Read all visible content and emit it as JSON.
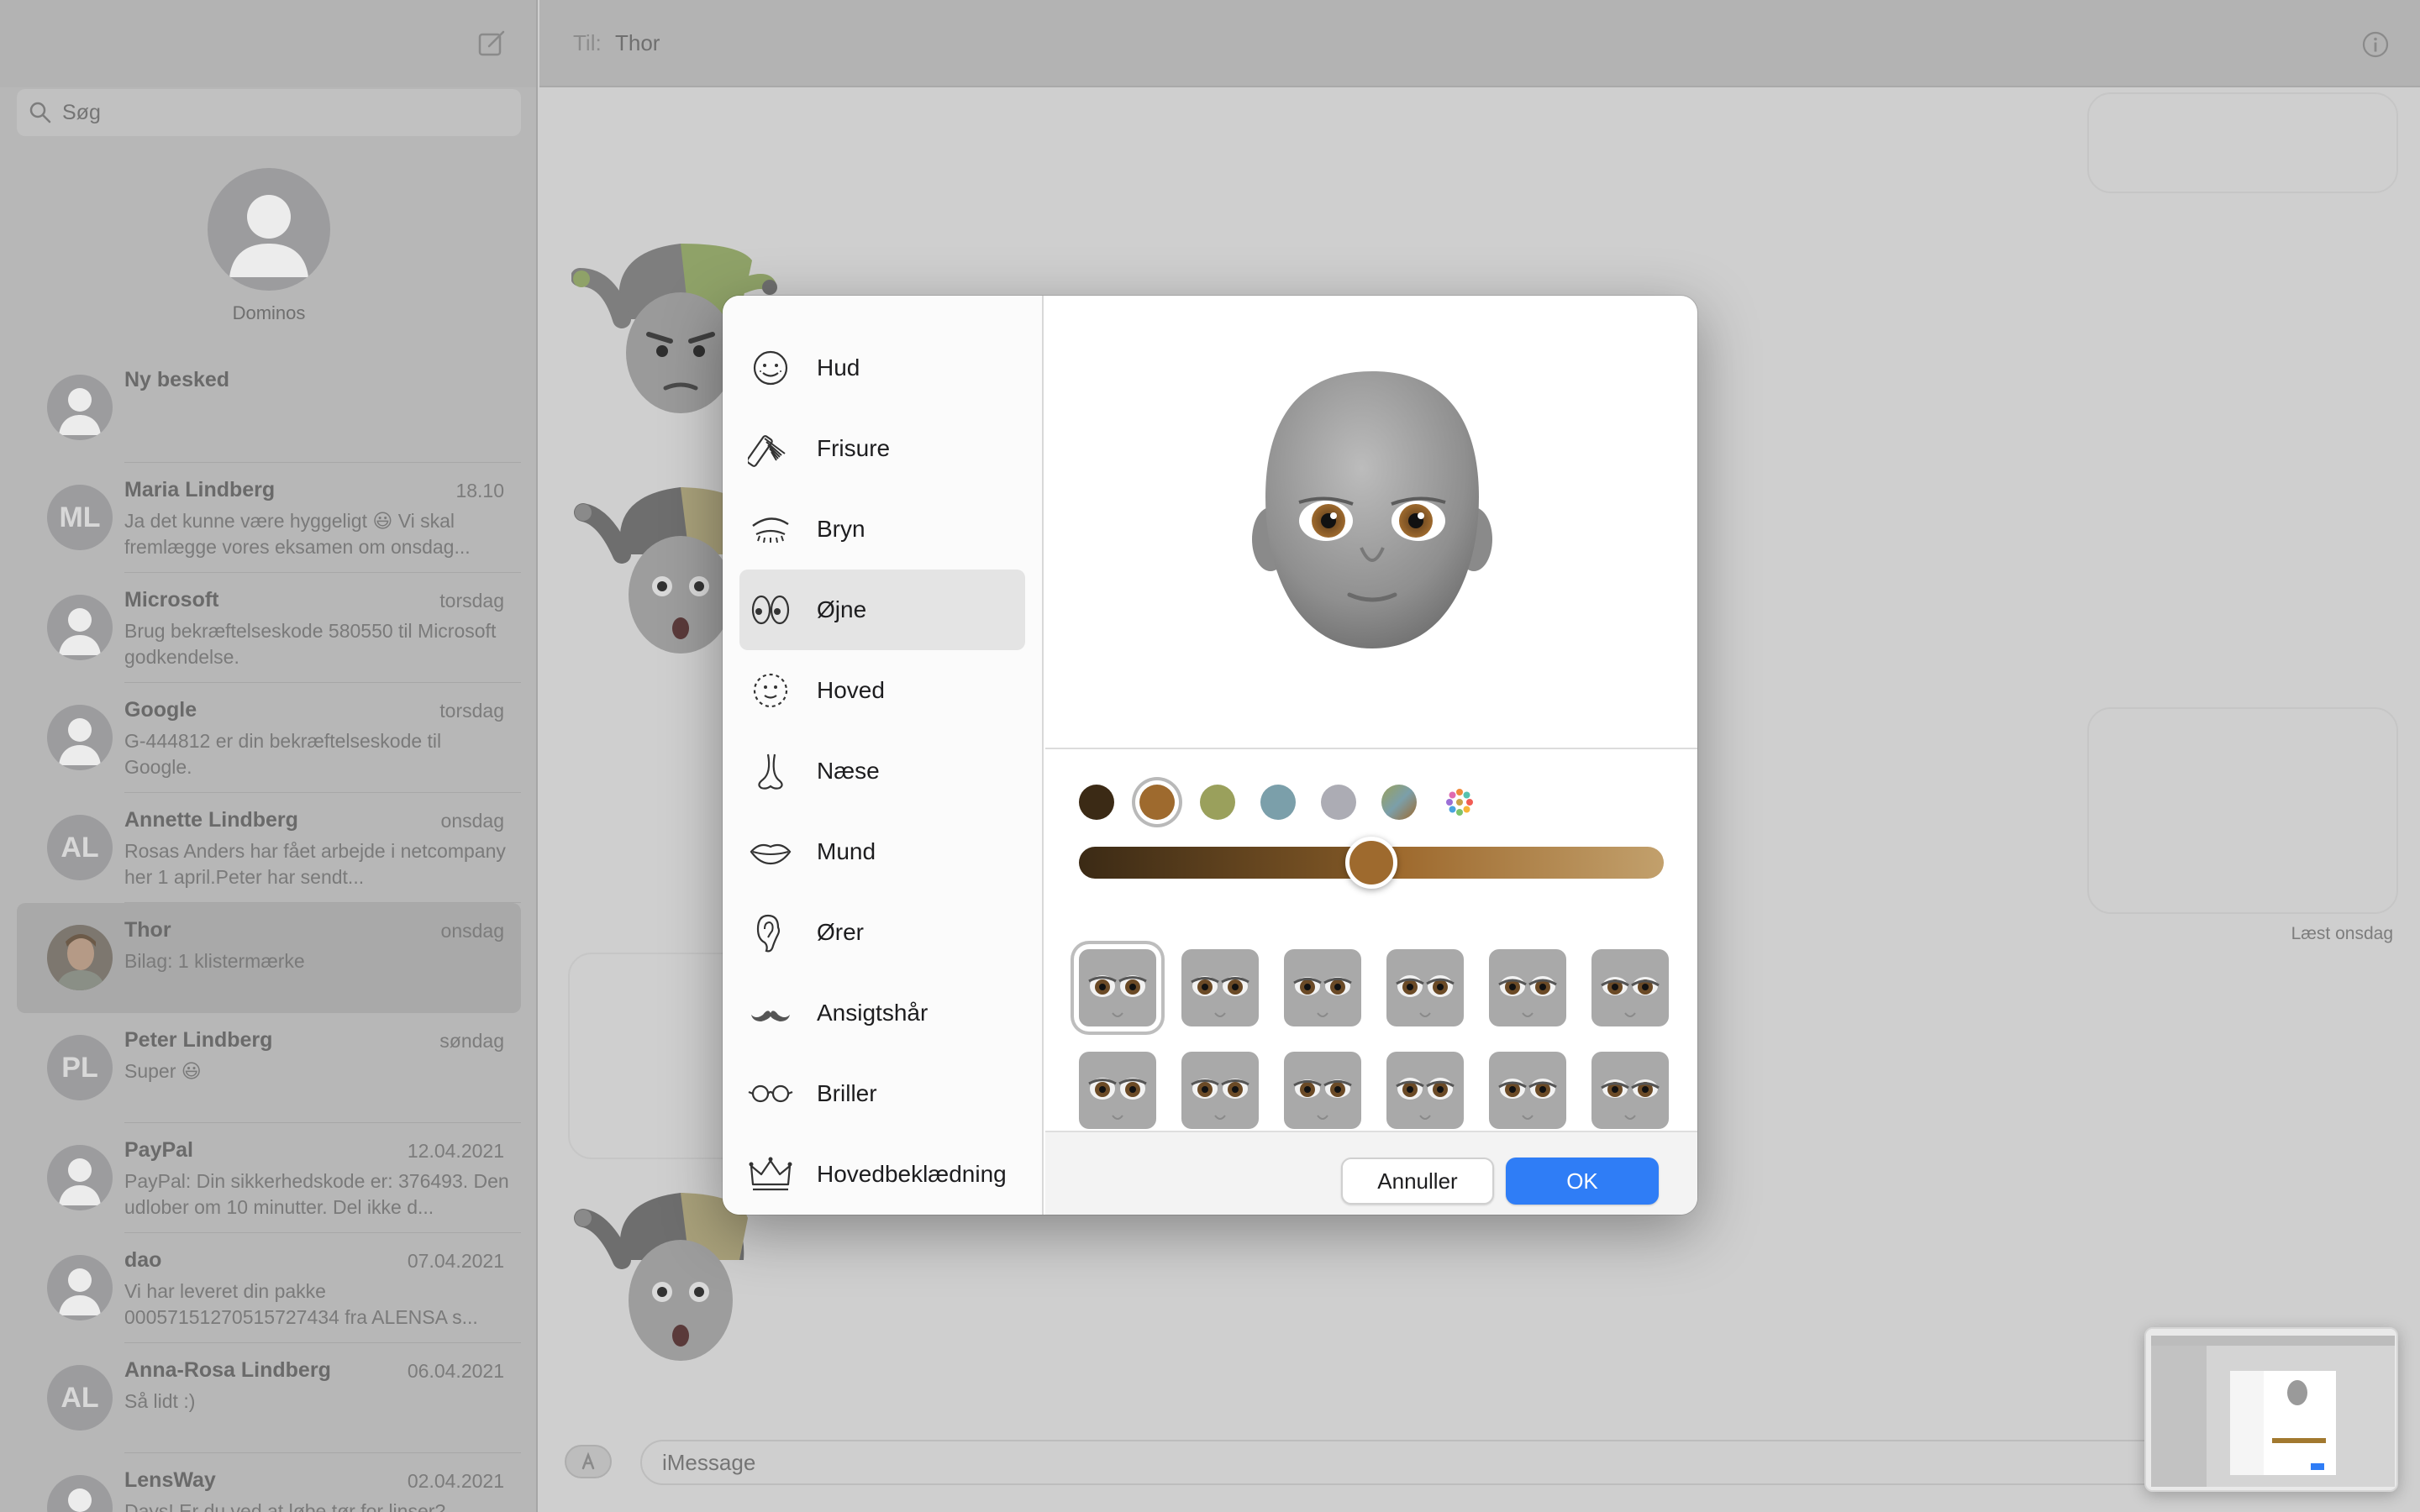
{
  "sidebar": {
    "search_placeholder": "Søg",
    "pinned": {
      "name": "Dominos"
    },
    "conversations": [
      {
        "name": "Ny besked",
        "date": "",
        "preview": "",
        "initials": "",
        "avatar": "person"
      },
      {
        "name": "Maria Lindberg",
        "date": "18.10",
        "preview": "Ja det kunne være hyggeligt 😃 Vi skal fremlægge vores eksamen om onsdag...",
        "initials": "ML",
        "avatar": "initials"
      },
      {
        "name": "Microsoft",
        "date": "torsdag",
        "preview": "Brug bekræftelseskode 580550 til Microsoft godkendelse.",
        "initials": "",
        "avatar": "person"
      },
      {
        "name": "Google",
        "date": "torsdag",
        "preview": "G-444812 er din bekræftelseskode til Google.",
        "initials": "",
        "avatar": "person"
      },
      {
        "name": "Annette Lindberg",
        "date": "onsdag",
        "preview": "Rosas Anders har fået arbejde i netcompany her 1 april.Peter har sendt...",
        "initials": "AL",
        "avatar": "initials"
      },
      {
        "name": "Thor",
        "date": "onsdag",
        "preview": "Bilag: 1 klistermærke",
        "initials": "",
        "avatar": "photo",
        "selected": true
      },
      {
        "name": "Peter Lindberg",
        "date": "søndag",
        "preview": "Super 😃",
        "initials": "PL",
        "avatar": "initials"
      },
      {
        "name": "PayPal",
        "date": "12.04.2021",
        "preview": "PayPal: Din sikkerhedskode er: 376493. Den udlober om 10 minutter. Del ikke d...",
        "initials": "",
        "avatar": "person"
      },
      {
        "name": "dao",
        "date": "07.04.2021",
        "preview": "Vi har leveret din pakke 00057151270515727434 fra ALENSA s...",
        "initials": "",
        "avatar": "person"
      },
      {
        "name": "Anna-Rosa Lindberg",
        "date": "06.04.2021",
        "preview": "Så lidt :)",
        "initials": "AL",
        "avatar": "initials"
      },
      {
        "name": "LensWay",
        "date": "02.04.2021",
        "preview": "Days! Er du ved at løbe tør for linser?",
        "initials": "",
        "avatar": "person"
      }
    ]
  },
  "chat": {
    "to_label": "Til:",
    "to_name": "Thor",
    "read_status": "Læst onsdag",
    "input_placeholder": "iMessage"
  },
  "dialog": {
    "categories": [
      {
        "label": "Hud",
        "icon": "face-icon"
      },
      {
        "label": "Frisure",
        "icon": "comb-icon"
      },
      {
        "label": "Bryn",
        "icon": "eyebrow-icon"
      },
      {
        "label": "Øjne",
        "icon": "eyes-icon",
        "active": true
      },
      {
        "label": "Hoved",
        "icon": "head-outline-icon"
      },
      {
        "label": "Næse",
        "icon": "nose-icon"
      },
      {
        "label": "Mund",
        "icon": "mouth-icon"
      },
      {
        "label": "Ører",
        "icon": "ear-icon"
      },
      {
        "label": "Ansigtshår",
        "icon": "mustache-icon"
      },
      {
        "label": "Briller",
        "icon": "glasses-icon"
      },
      {
        "label": "Hovedbeklædning",
        "icon": "crown-icon"
      }
    ],
    "eye_colors": [
      "#3b2a15",
      "#9e6a2e",
      "#9aa05c",
      "#7b9faa",
      "#acacb4",
      "gradient",
      "multicolor"
    ],
    "selected_eye_color_index": 1,
    "slider_value": 0.5,
    "eye_shape_count_visible": 12,
    "selected_eye_shape_index": 0,
    "cancel_label": "Annuller",
    "ok_label": "OK"
  }
}
